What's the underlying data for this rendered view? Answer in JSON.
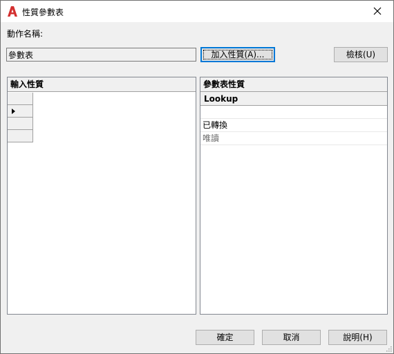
{
  "window": {
    "title": "性質參數表",
    "icon": "autocad-a-icon",
    "colors": {
      "icon_red": "#d32f2f",
      "focus_blue": "#0078d7"
    }
  },
  "action_name": {
    "label": "動作名稱:",
    "value": "參數表"
  },
  "buttons": {
    "add_properties": "加入性質(A)...",
    "audit": "檢核(U)",
    "ok": "確定",
    "cancel": "取消",
    "help": "說明(H)"
  },
  "input_properties": {
    "header": "輸入性質"
  },
  "lookup_properties": {
    "header": "參數表性質",
    "column": "Lookup",
    "rows": [
      "",
      "已轉換",
      "唯讀"
    ]
  }
}
